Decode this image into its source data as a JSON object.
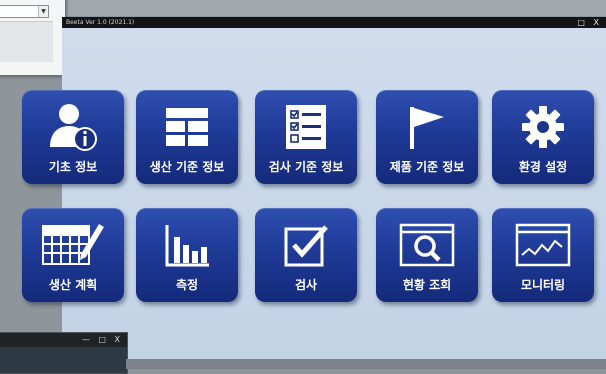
{
  "main_window": {
    "title": "Beeta Ver 1.0 (2021.1)",
    "controls": "□ X"
  },
  "tiles": [
    {
      "label": "기초 정보",
      "icon": "user-info-icon"
    },
    {
      "label": "생산 기준 정보",
      "icon": "grid-table-icon"
    },
    {
      "label": "검사 기준 정보",
      "icon": "checklist-icon"
    },
    {
      "label": "제품 기준 정보",
      "icon": "flag-icon"
    },
    {
      "label": "환경 설정",
      "icon": "gear-icon"
    },
    {
      "label": "생산 계획",
      "icon": "calendar-pencil-icon"
    },
    {
      "label": "측정",
      "icon": "bar-chart-icon"
    },
    {
      "label": "검사",
      "icon": "checkbox-icon"
    },
    {
      "label": "현황 조회",
      "icon": "search-window-icon"
    },
    {
      "label": "모니터링",
      "icon": "line-chart-icon"
    }
  ],
  "bottom_left_window": {
    "controls": "— □ X"
  },
  "colors": {
    "tile_top": "#2f4fb0",
    "tile_bottom": "#142a7a",
    "main_background": "#c7d6e8",
    "titlebar": "#121418"
  }
}
